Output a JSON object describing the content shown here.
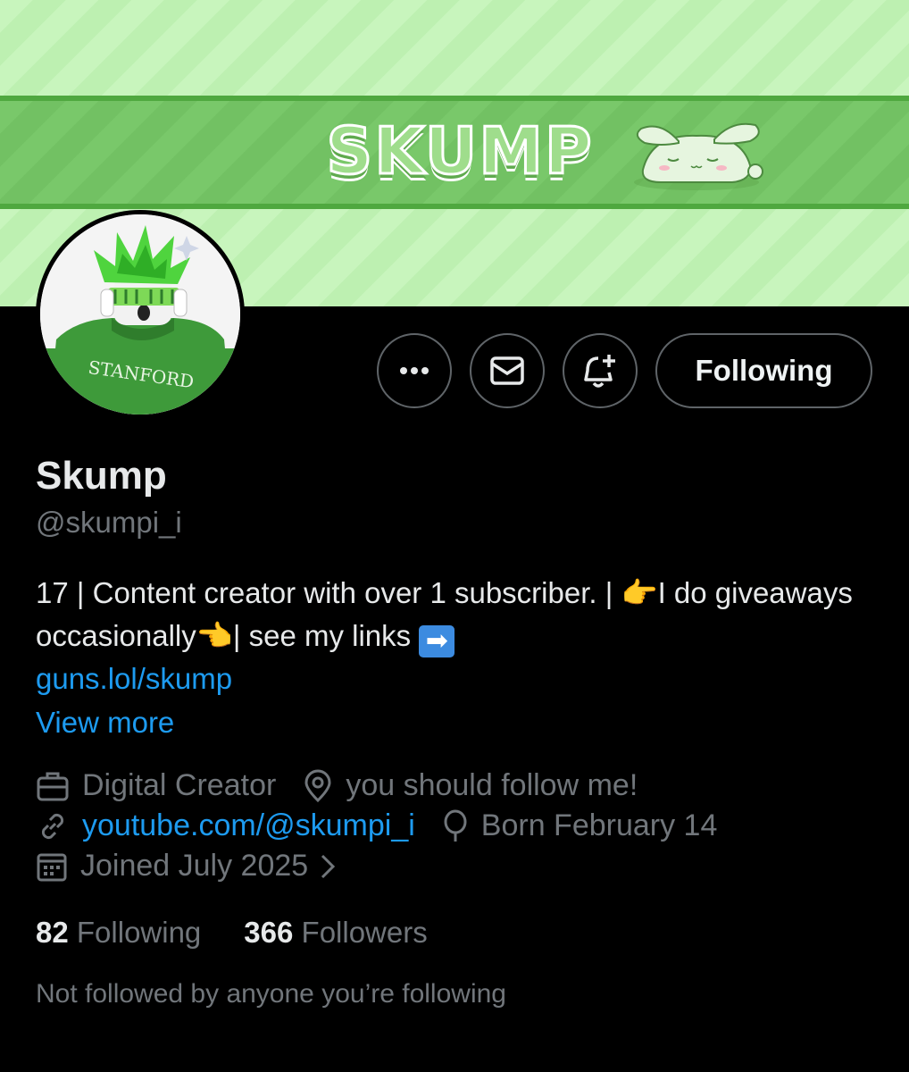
{
  "banner": {
    "title": "SKUMP"
  },
  "actions": {
    "more_label": "More",
    "message_label": "Message",
    "notify_label": "Notifications",
    "following_label": "Following"
  },
  "profile": {
    "name": "Skump",
    "handle": "@skumpi_i",
    "bio_part1": "17 | Content creator with over 1 subscriber. | ",
    "bio_emoji_left": "👉",
    "bio_part2": "I do giveaways occasionally",
    "bio_emoji_right": "👈",
    "bio_part3": "| see my links ",
    "bio_arrow": "➡",
    "bio_link": "guns.lol/skump",
    "view_more": "View more"
  },
  "meta": {
    "category": "Digital Creator",
    "location": "you should follow me!",
    "website": "youtube.com/@skumpi_i",
    "birthday": "Born February 14",
    "joined": "Joined July 2025"
  },
  "stats": {
    "following_count": "82",
    "following_label": "Following",
    "followers_count": "366",
    "followers_label": "Followers"
  },
  "social_context": "Not followed by anyone you’re following",
  "colors": {
    "accent": "#1d9bf0",
    "banner_light": "#c8f5bd",
    "banner_strip": "#79c86a",
    "muted": "#71767b"
  },
  "icons": [
    "more-icon",
    "mail-icon",
    "bell-plus-icon",
    "briefcase-icon",
    "location-pin-icon",
    "link-icon",
    "balloon-icon",
    "calendar-icon",
    "chevron-right-icon"
  ]
}
